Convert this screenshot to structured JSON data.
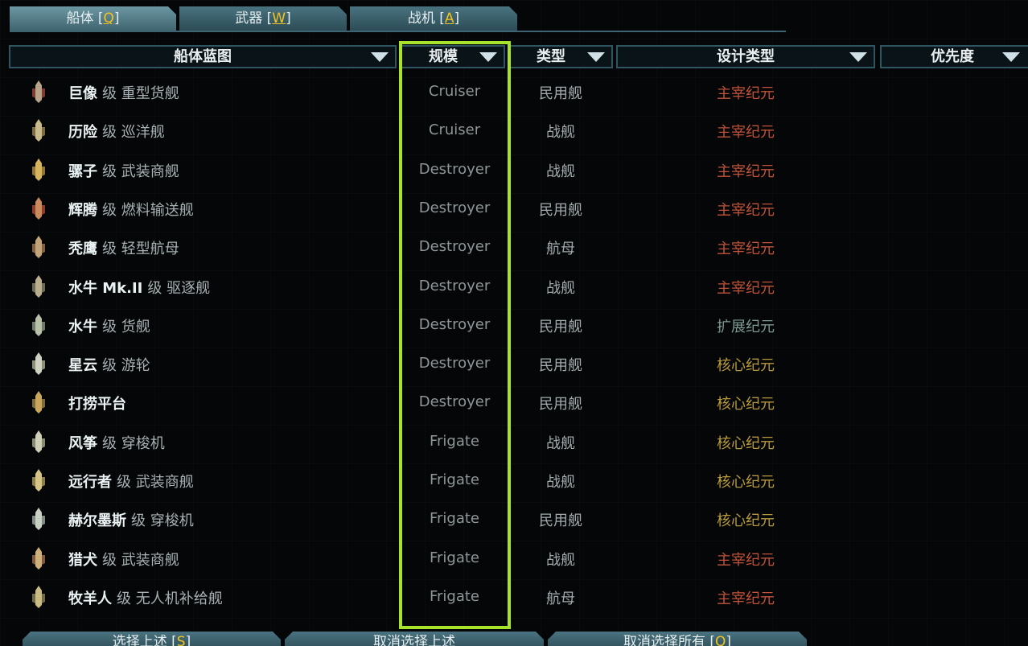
{
  "tabs": [
    {
      "label": "船体 [",
      "key": "Q",
      "suffix": "]"
    },
    {
      "label": "武器 [",
      "key": "W",
      "suffix": "]"
    },
    {
      "label": "战机 [",
      "key": "A",
      "suffix": "]"
    }
  ],
  "headers": {
    "name": "船体蓝图",
    "size": "规模",
    "type": "类型",
    "design": "设计类型",
    "priority": "优先度"
  },
  "colors": {
    "highlight": "#a6e32a",
    "domain": "#c0523a",
    "frontier": "#7f9a93",
    "core": "#b89a3c",
    "hotkey": "#f4c21c"
  },
  "rows": [
    {
      "name": "巨像",
      "cls": "级 重型货舰",
      "size": "Cruiser",
      "type": "民用舰",
      "design": "主宰纪元",
      "tone": "domain",
      "icon": "freighter-heavy-icon",
      "c1": "#b8a48a",
      "c2": "#7d3a33"
    },
    {
      "name": "历险",
      "cls": "级 巡洋舰",
      "size": "Cruiser",
      "type": "战舰",
      "design": "主宰纪元",
      "tone": "domain",
      "icon": "cruiser-icon",
      "c1": "#c9b98c",
      "c2": "#7a6a3e"
    },
    {
      "name": "骡子",
      "cls": "级 武装商舰",
      "size": "Destroyer",
      "type": "战舰",
      "design": "主宰纪元",
      "tone": "domain",
      "icon": "armed-freighter-icon",
      "c1": "#d7b55e",
      "c2": "#8f7436"
    },
    {
      "name": "辉腾",
      "cls": "级 燃料输送舰",
      "size": "Destroyer",
      "type": "民用舰",
      "design": "主宰纪元",
      "tone": "domain",
      "icon": "tanker-icon",
      "c1": "#c98a5e",
      "c2": "#8d3b2a"
    },
    {
      "name": "秃鹰",
      "cls": "级 轻型航母",
      "size": "Destroyer",
      "type": "航母",
      "design": "主宰纪元",
      "tone": "domain",
      "icon": "carrier-icon",
      "c1": "#c2a47a",
      "c2": "#80603e"
    },
    {
      "name": "水牛 Mk.II",
      "cls": "级 驱逐舰",
      "size": "Destroyer",
      "type": "战舰",
      "design": "主宰纪元",
      "tone": "domain",
      "icon": "destroyer-icon",
      "c1": "#b9ad8e",
      "c2": "#6b6a55"
    },
    {
      "name": "水牛",
      "cls": "级 货舰",
      "size": "Destroyer",
      "type": "民用舰",
      "design": "扩展纪元",
      "tone": "frontier",
      "icon": "freighter-icon",
      "c1": "#b8c0a8",
      "c2": "#6f7a6a"
    },
    {
      "name": "星云",
      "cls": "级 游轮",
      "size": "Destroyer",
      "type": "民用舰",
      "design": "核心纪元",
      "tone": "core",
      "icon": "liner-icon",
      "c1": "#cfd2c0",
      "c2": "#8d8e7a"
    },
    {
      "name": "打捞平台",
      "cls": "",
      "size": "Destroyer",
      "type": "民用舰",
      "design": "核心纪元",
      "tone": "core",
      "icon": "salvage-rig-icon",
      "c1": "#c9a65e",
      "c2": "#7c6a3c"
    },
    {
      "name": "风筝",
      "cls": "级 穿梭机",
      "size": "Frigate",
      "type": "战舰",
      "design": "核心纪元",
      "tone": "core",
      "icon": "shuttle-icon",
      "c1": "#cfcfb8",
      "c2": "#8a8a70"
    },
    {
      "name": "远行者",
      "cls": "级 武装商舰",
      "size": "Frigate",
      "type": "战舰",
      "design": "核心纪元",
      "tone": "core",
      "icon": "armed-freighter-icon",
      "c1": "#d4c488",
      "c2": "#8b7c48"
    },
    {
      "name": "赫尔墨斯",
      "cls": "级 穿梭机",
      "size": "Frigate",
      "type": "民用舰",
      "design": "核心纪元",
      "tone": "core",
      "icon": "shuttle-icon",
      "c1": "#c8d0c4",
      "c2": "#7f8a82"
    },
    {
      "name": "猎犬",
      "cls": "级 武装商舰",
      "size": "Frigate",
      "type": "战舰",
      "design": "主宰纪元",
      "tone": "domain",
      "icon": "armed-freighter-icon",
      "c1": "#cdb07a",
      "c2": "#7d5a3e"
    },
    {
      "name": "牧羊人",
      "cls": "级 无人机补给舰",
      "size": "Frigate",
      "type": "航母",
      "design": "主宰纪元",
      "tone": "domain",
      "icon": "drone-tender-icon",
      "c1": "#c9bb82",
      "c2": "#6e6a48"
    }
  ],
  "buttons": [
    {
      "label": "选择上述 [",
      "key": "S",
      "suffix": "]"
    },
    {
      "label": "取消选择上述",
      "key": "",
      "suffix": ""
    },
    {
      "label": "取消选择所有 [",
      "key": "Q",
      "suffix": "]"
    }
  ]
}
